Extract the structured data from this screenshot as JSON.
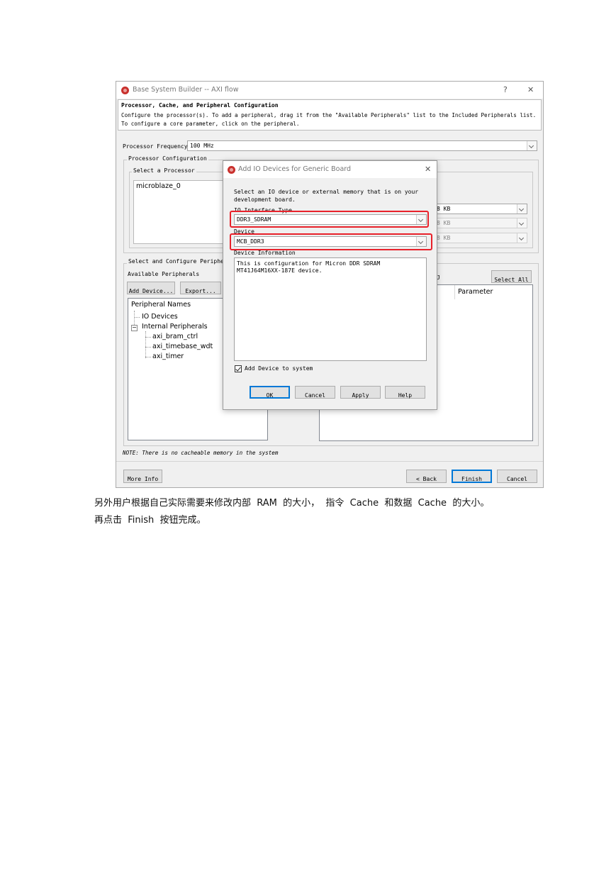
{
  "main_window": {
    "title": "Base System Builder -- AXI flow",
    "help_glyph": "?",
    "close_glyph": "✕",
    "header_title": "Processor, Cache, and Peripheral Configuration",
    "header_line1": "Configure the processor(s). To add a peripheral, drag it from the \"Available Peripherals\" list to the Included Peripherals list.",
    "header_line2": "To configure a core parameter, click on the peripheral.",
    "processor_frequency_label": "Processor Frequency",
    "processor_frequency_value": "100 MHz",
    "processor_config_legend": "Processor Configuration",
    "select_processor_legend": "Select a Processor",
    "processor_list": [
      "microblaze_0"
    ],
    "right_combo_values": [
      "8 KB",
      "8 KB",
      "8 KB"
    ],
    "select_configure_legend": "Select and Configure Periphera",
    "available_peripherals_label": "Available Peripherals",
    "add_device_button": "Add Device...",
    "export_button": "Export...",
    "peripheral_tree": {
      "header": "Peripheral Names",
      "io_devices": "IO Devices",
      "internal_peripherals": "Internal Peripherals",
      "children": [
        "axi_bram_ctrl",
        "axi_timebase_wdt",
        "axi_timer"
      ]
    },
    "select_all_button": "Select All",
    "parameter_header": "Parameter",
    "note": "NOTE: There is no cacheable memory in the system",
    "more_info_button": "More Info",
    "back_button": "< Back",
    "finish_button": "Finish",
    "cancel_button": "Cancel"
  },
  "dialog": {
    "title": "Add IO Devices for Generic Board",
    "close_glyph": "✕",
    "instruction_line1": "Select an IO device or external memory that is on your",
    "instruction_line2": "development board.",
    "io_interface_type_label": "IO Interface Type",
    "io_interface_type_value": "DDR3_SDRAM",
    "device_label": "Device",
    "device_value": "MCB_DDR3",
    "device_info_label": "Device Information",
    "device_info_line1": "This is configuration for Micron DDR SDRAM",
    "device_info_line2": "MT41J64M16XX-187E device.",
    "add_to_system_label": "Add Device to system",
    "add_to_system_checked": true,
    "ok_button": "OK",
    "cancel_button": "Cancel",
    "apply_button": "Apply",
    "help_button": "Help"
  },
  "caption": {
    "line1": "另外用户根据自己实际需要来修改内部  RAM  的大小，  指令  Cache  和数据  Cache  的大小。",
    "line2": "再点击  Finish  按钮完成。"
  },
  "colors": {
    "highlight_red": "#e8212a",
    "window_bg": "#f0f0f0",
    "default_button_border": "#0078d7"
  }
}
